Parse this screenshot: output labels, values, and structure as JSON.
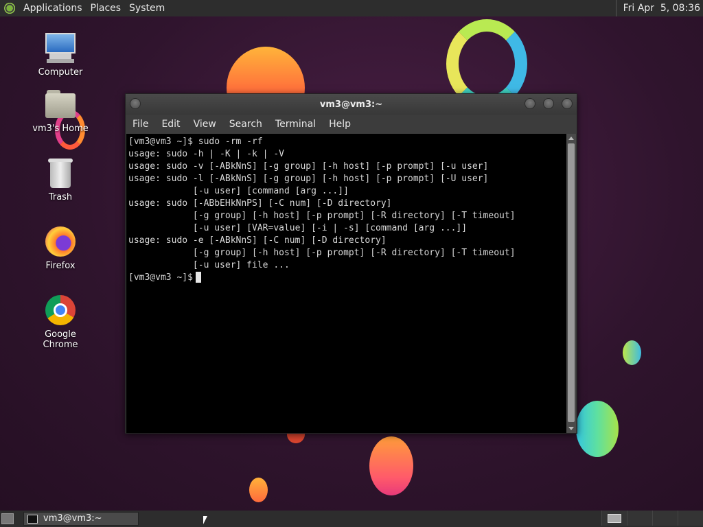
{
  "top_panel": {
    "menus": [
      "Applications",
      "Places",
      "System"
    ],
    "clock": "Fri Apr  5, 08:36"
  },
  "desktop_icons": [
    {
      "label": "Computer",
      "icon": "computer-icon"
    },
    {
      "label": "vm3's Home",
      "icon": "home-folder-icon"
    },
    {
      "label": "Trash",
      "icon": "trash-icon"
    },
    {
      "label": "Firefox",
      "icon": "firefox-icon"
    },
    {
      "label": "Google Chrome",
      "icon": "chrome-icon"
    }
  ],
  "terminal": {
    "title": "vm3@vm3:~",
    "menu": [
      "File",
      "Edit",
      "View",
      "Search",
      "Terminal",
      "Help"
    ],
    "lines": [
      "[vm3@vm3 ~]$ sudo -rm -rf",
      "usage: sudo -h | -K | -k | -V",
      "usage: sudo -v [-ABkNnS] [-g group] [-h host] [-p prompt] [-u user]",
      "usage: sudo -l [-ABkNnS] [-g group] [-h host] [-p prompt] [-U user]",
      "            [-u user] [command [arg ...]]",
      "usage: sudo [-ABbEHkNnPS] [-C num] [-D directory]",
      "            [-g group] [-h host] [-p prompt] [-R directory] [-T timeout]",
      "            [-u user] [VAR=value] [-i | -s] [command [arg ...]]",
      "usage: sudo -e [-ABkNnS] [-C num] [-D directory]",
      "            [-g group] [-h host] [-p prompt] [-R directory] [-T timeout]",
      "            [-u user] file ..."
    ],
    "prompt": "[vm3@vm3 ~]$"
  },
  "bottom_panel": {
    "task_label": "vm3@vm3:~"
  }
}
